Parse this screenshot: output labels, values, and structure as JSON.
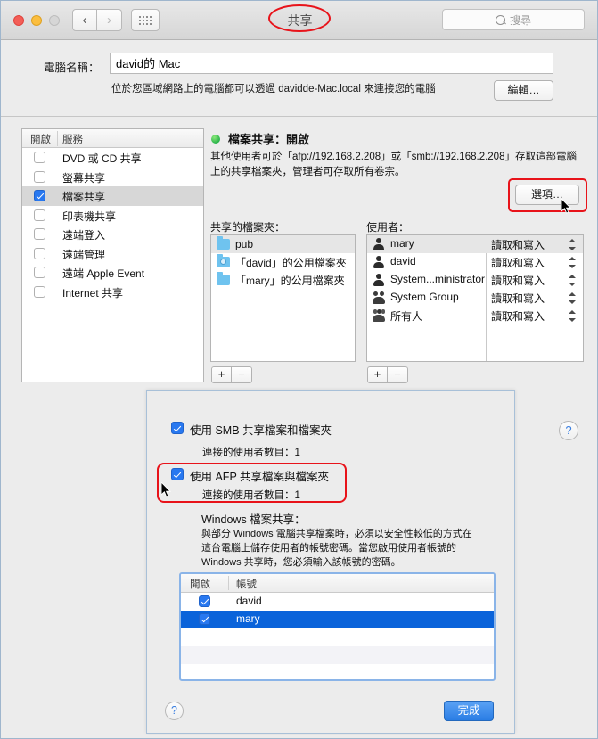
{
  "window": {
    "title": "共享",
    "search_placeholder": "搜尋"
  },
  "computer_name": {
    "label": "電腦名稱：",
    "value": "david的 Mac",
    "note": "位於您區域網路上的電腦都可以透過 davidde-Mac.local 來連接您的電腦",
    "edit_button": "編輯…"
  },
  "services": {
    "header_on": "開啟",
    "header_service": "服務",
    "items": [
      {
        "label": "DVD 或 CD 共享",
        "checked": false,
        "selected": false
      },
      {
        "label": "螢幕共享",
        "checked": false,
        "selected": false
      },
      {
        "label": "檔案共享",
        "checked": true,
        "selected": true
      },
      {
        "label": "印表機共享",
        "checked": false,
        "selected": false
      },
      {
        "label": "遠端登入",
        "checked": false,
        "selected": false
      },
      {
        "label": "遠端管理",
        "checked": false,
        "selected": false
      },
      {
        "label": "遠端 Apple Event",
        "checked": false,
        "selected": false
      },
      {
        "label": "Internet 共享",
        "checked": false,
        "selected": false
      }
    ]
  },
  "detail": {
    "status_title": "檔案共享：開啟",
    "status_color": "#29b34a",
    "description": "其他使用者可於「afp://192.168.2.208」或「smb://192.168.2.208」存取這部電腦上的共享檔案夾，管理者可存取所有卷宗。",
    "options_button": "選項…",
    "shared_folders_label": "共享的檔案夾：",
    "users_label": "使用者：",
    "shared_folders": [
      {
        "name": "pub",
        "icon": "folder-icon",
        "selected": true
      },
      {
        "name": "「david」的公用檔案夾",
        "icon": "dropbox-folder-icon",
        "selected": false
      },
      {
        "name": "「mary」的公用檔案夾",
        "icon": "folder-icon",
        "selected": false
      }
    ],
    "users": [
      {
        "name": "mary",
        "icon": "person-icon",
        "permission": "讀取和寫入",
        "selected": true
      },
      {
        "name": "david",
        "icon": "person-icon",
        "permission": "讀取和寫入",
        "selected": false
      },
      {
        "name": "System...ministrator",
        "icon": "person-icon",
        "permission": "讀取和寫入",
        "selected": false
      },
      {
        "name": "System Group",
        "icon": "group-icon",
        "permission": "讀取和寫入",
        "selected": false
      },
      {
        "name": "所有人",
        "icon": "everyone-icon",
        "permission": "讀取和寫入",
        "selected": false
      }
    ],
    "add_button": "+",
    "remove_button": "−",
    "help_button": "?"
  },
  "sheet": {
    "smb_label": "使用 SMB 共享檔案和檔案夾",
    "smb_checked": true,
    "smb_connected": "連接的使用者數目：1",
    "afp_label": "使用 AFP 共享檔案與檔案夾",
    "afp_checked": true,
    "afp_connected": "連接的使用者數目：1",
    "windows_heading": "Windows 檔案共享：",
    "windows_desc": "與部分 Windows 電腦共享檔案時，必須以安全性較低的方式在這台電腦上儲存使用者的帳號密碼。當您啟用使用者帳號的 Windows 共享時，您必須輸入該帳號的密碼。",
    "accounts_header_on": "開啟",
    "accounts_header_account": "帳號",
    "accounts": [
      {
        "name": "david",
        "checked": true,
        "selected": false
      },
      {
        "name": "mary",
        "checked": true,
        "selected": true
      }
    ],
    "help_button": "?",
    "done_button": "完成"
  },
  "annotations": {
    "color": "#e8131a",
    "title_ellipse": "共享",
    "options_rect": "選項…",
    "afp_rect": "使用 AFP 共享檔案與檔案夾"
  }
}
